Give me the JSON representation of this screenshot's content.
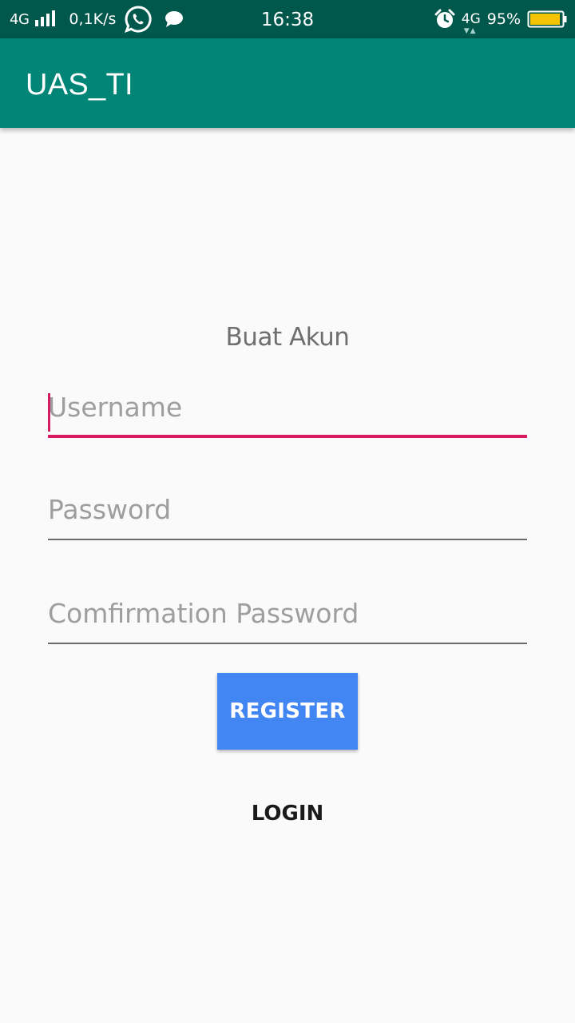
{
  "status_bar": {
    "network": "4G",
    "speed": "0,1K/s",
    "time": "16:38",
    "network_right": "4G",
    "battery": "95%",
    "icons": [
      "signal-icon",
      "whatsapp-icon",
      "chat-icon",
      "alarm-icon",
      "battery-icon"
    ],
    "battery_level": 0.95,
    "battery_color": "#f5c400"
  },
  "app_bar": {
    "title": "UAS_TI",
    "color": "#008577"
  },
  "form": {
    "title": "Buat Akun",
    "username": {
      "placeholder": "Username",
      "value": ""
    },
    "password": {
      "placeholder": "Password",
      "value": ""
    },
    "confirm_password": {
      "placeholder": "Comfirmation Password",
      "value": ""
    },
    "focused_field": "username",
    "accent_color": "#d81b60"
  },
  "actions": {
    "register_label": "REGISTER",
    "register_color": "#4286f4",
    "login_label": "LOGIN"
  }
}
